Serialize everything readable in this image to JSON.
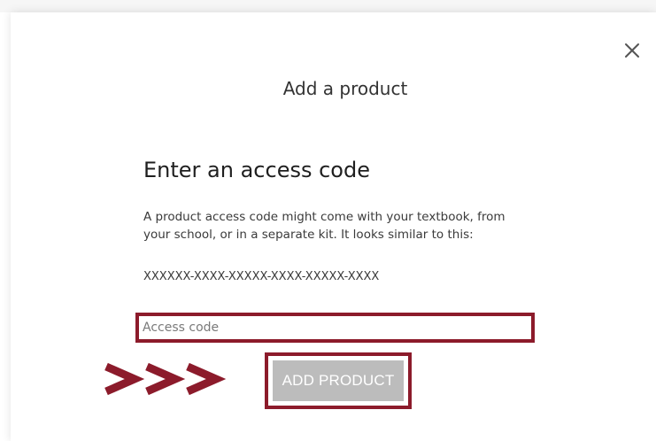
{
  "modal": {
    "title": "Add a product",
    "close_icon": "close-icon"
  },
  "section": {
    "heading": "Enter an access code",
    "description": "A product access code might come with your textbook, from your school, or in a separate kit. It looks similar to this:",
    "code_example": "XXXXXX-XXXX-XXXXX-XXXX-XXXXX-XXXX"
  },
  "access_input": {
    "placeholder": "Access code",
    "value": ""
  },
  "add_button": {
    "label": "ADD PRODUCT",
    "state": "disabled"
  },
  "annotation": {
    "arrows_text": ">>>",
    "highlight_color": "#8c1b2b"
  },
  "colors": {
    "button_disabled_bg": "#bcbcbc",
    "button_text": "#ffffff",
    "heading_text": "#1f1f1f",
    "body_text": "#3a3a3a"
  }
}
